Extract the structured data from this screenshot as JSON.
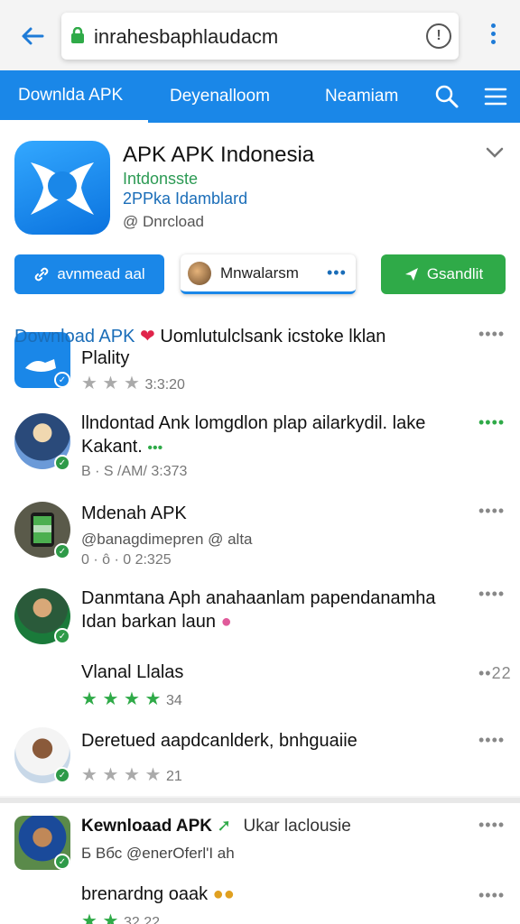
{
  "browser": {
    "url": "inrahesbaphlaudacm",
    "info_label": "!"
  },
  "nav": {
    "tabs": [
      {
        "label": "Downlda APK",
        "active": true
      },
      {
        "label": "Deyenalloom",
        "active": false
      },
      {
        "label": "Neamiam",
        "active": false
      }
    ]
  },
  "app": {
    "title": "APK APK Indonesia",
    "subtitle1": "Intdonsste",
    "subtitle2": "2PPka Idamblard",
    "subtitle3": "@ Dnrcload",
    "actions": {
      "left_label": "avnmead aal",
      "middle_label": "Mnwalarsm",
      "middle_more": "•••",
      "right_label": "Gsandlit"
    }
  },
  "feed": [
    {
      "title": "Download APK",
      "title_rest": "Uomlutulclsank  icstoke lklan",
      "line2": "Plality",
      "meta": "3:3:20",
      "stars_on": 0,
      "stars_total": 3,
      "more": "••••"
    },
    {
      "title": "llndontad Ank  lomgdlon plap ailarkydil. lake",
      "line2": "Kakant.",
      "line2_extra": "•••",
      "meta": "В · S /AM/ 3:373",
      "more": "••••"
    },
    {
      "title": "Mdenah APK",
      "line2": "@banagdimepren @ alta",
      "meta": "0 · ô · 0 2:325",
      "more": "••••"
    },
    {
      "title": "Danmtana Aph anahaanlam papendanamha",
      "line2": "Idan barkan laun",
      "more": "••••"
    },
    {
      "title": "Vlanal Llalas",
      "meta": "34",
      "stars_on": 4,
      "stars_total": 4,
      "more": "••22"
    },
    {
      "title": "Deretued aapdcanlderk, bnhguaiie",
      "meta": "21",
      "stars_on": 0,
      "stars_total": 4,
      "more": "••••"
    }
  ],
  "lower": {
    "title": "Kewnloaad APK",
    "title_rest": "Ukar laclousie",
    "line2": "Б Вбс @enerOferl'I ah",
    "line3": "brenardng oaak",
    "more": "••••",
    "more2": "••••",
    "meta": "32 22"
  },
  "colors": {
    "primary_blue": "#1a87e8",
    "accent_green": "#2faa48",
    "link_blue": "#1a6db8"
  }
}
